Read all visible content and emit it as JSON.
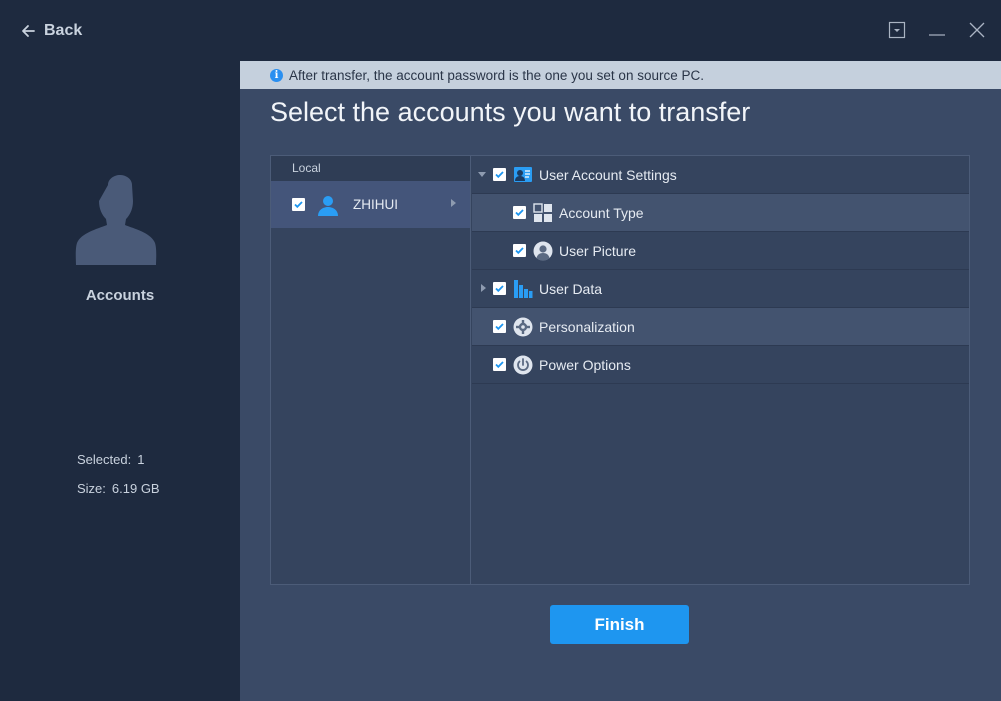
{
  "titlebar": {
    "back_label": "Back",
    "icons": [
      "arrow-left-icon",
      "dropdown-box-icon",
      "minimize-icon",
      "close-icon"
    ]
  },
  "sidebar": {
    "section_label": "Accounts",
    "selected_key": "Selected:",
    "selected_value": "1",
    "size_key": "Size:",
    "size_value": "6.19 GB"
  },
  "main": {
    "info_text": "After transfer, the account password is the one you set on source PC.",
    "heading": "Select the accounts you want to transfer",
    "local_header": "Local",
    "user": {
      "name": "ZHIHUI",
      "checked": true
    },
    "tree": [
      {
        "label": "User Account Settings",
        "checked": true,
        "level": 0,
        "expander": "expanded",
        "icon": "user-settings-icon"
      },
      {
        "label": "Account Type",
        "checked": true,
        "level": 1,
        "expander": "none",
        "icon": "grid-icon"
      },
      {
        "label": "User Picture",
        "checked": true,
        "level": 1,
        "expander": "none",
        "icon": "user-picture-icon"
      },
      {
        "label": "User Data",
        "checked": true,
        "level": 0,
        "expander": "collapsed",
        "icon": "bar-chart-icon"
      },
      {
        "label": "Personalization",
        "checked": true,
        "level": 0,
        "expander": "none",
        "icon": "gear-icon"
      },
      {
        "label": "Power Options",
        "checked": true,
        "level": 0,
        "expander": "none",
        "icon": "power-icon"
      }
    ],
    "finish_label": "Finish"
  },
  "colors": {
    "accent": "#1e96f0",
    "sidebar_bg": "#1e2a3f",
    "main_bg": "#3a4a66",
    "info_bar_bg": "#c5d0dd"
  }
}
